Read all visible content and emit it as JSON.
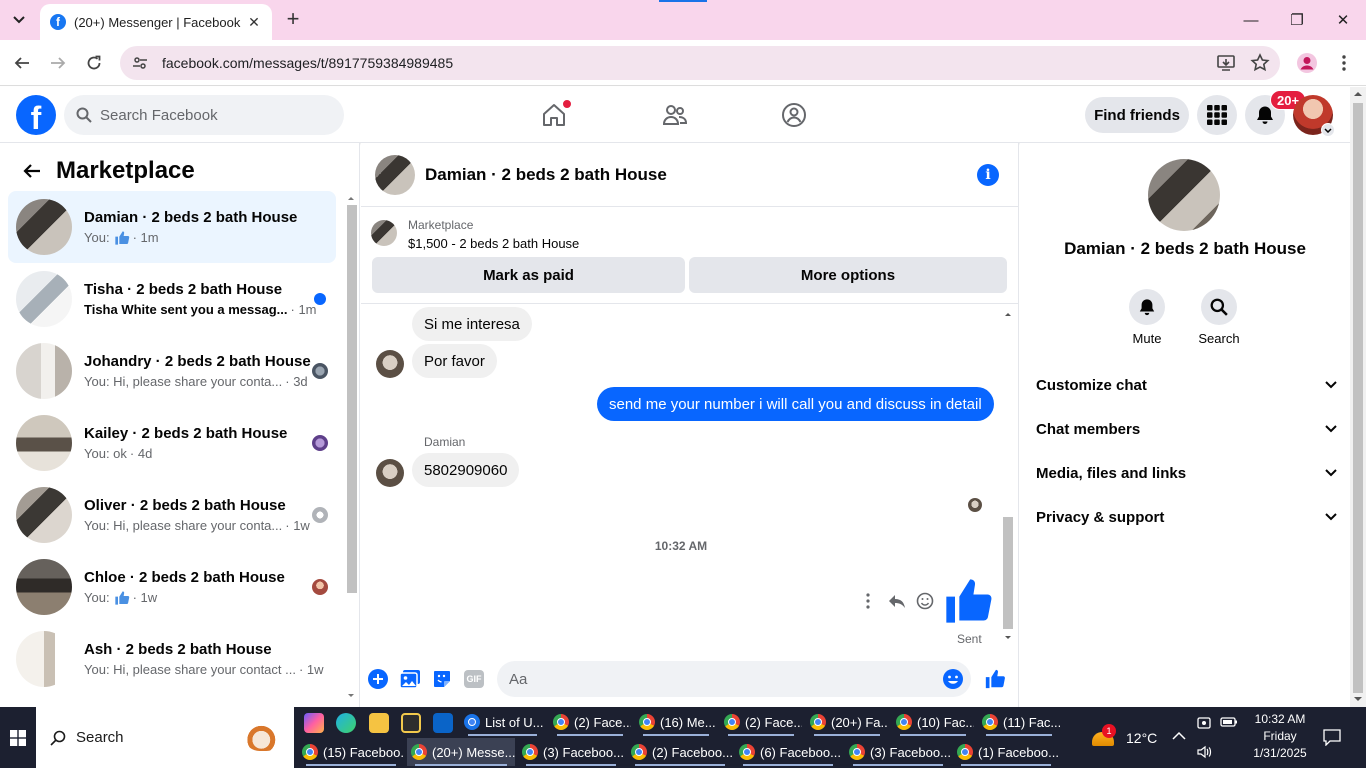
{
  "browser": {
    "tab_title": "(20+) Messenger | Facebook",
    "url": "facebook.com/messages/t/8917759384989485",
    "tab_icon": "f"
  },
  "fb": {
    "logo_letter": "f",
    "search_placeholder": "Search Facebook",
    "find_friends": "Find friends",
    "notif_badge": "20+",
    "brand_color": "#0866ff"
  },
  "left": {
    "heading": "Marketplace",
    "conversations": [
      {
        "name": "Damian · 2 beds 2 bath House",
        "preview_pre": "You:",
        "preview_text": "",
        "time": "· 1m",
        "like": true,
        "active": true,
        "unread": false
      },
      {
        "name": "Tisha · 2 beds 2 bath House",
        "preview_pre": "",
        "preview_text": "Tisha White sent you a messag...",
        "time": "· 1m",
        "like": false,
        "active": false,
        "unread": true
      },
      {
        "name": "Johandry · 2 beds 2 bath House",
        "preview_pre": "",
        "preview_text": "You: Hi, please share your conta...",
        "time": "· 3d",
        "like": false,
        "active": false,
        "unread": false
      },
      {
        "name": "Kailey · 2 beds 2 bath House",
        "preview_pre": "",
        "preview_text": "You: ok",
        "time": "· 4d",
        "like": false,
        "active": false,
        "unread": false
      },
      {
        "name": "Oliver · 2 beds 2 bath House",
        "preview_pre": "",
        "preview_text": "You: Hi, please share your conta...",
        "time": "· 1w",
        "like": false,
        "active": false,
        "unread": false
      },
      {
        "name": "Chloe · 2 beds 2 bath House",
        "preview_pre": "You:",
        "preview_text": "",
        "time": "· 1w",
        "like": true,
        "active": false,
        "unread": false
      },
      {
        "name": "Ash · 2 beds 2 bath House",
        "preview_pre": "",
        "preview_text": "You: Hi, please share your contact ...",
        "time": "· 1w",
        "like": false,
        "active": false,
        "unread": false
      }
    ]
  },
  "chat": {
    "title": "Damian · 2 beds 2 bath House",
    "info_glyph": "i",
    "marketplace_label": "Marketplace",
    "listing": "$1,500 - 2 beds 2 bath House",
    "mark_paid": "Mark as paid",
    "more_options": "More options",
    "messages": {
      "m1": "Si me interesa",
      "m2": "Por favor",
      "m3": "send me your number i will call you and discuss in detail",
      "sender": "Damian",
      "m4": "5802909060"
    },
    "timestamp": "10:32 AM",
    "sent_label": "Sent",
    "composer_placeholder": "Aa",
    "gif_label": "GIF"
  },
  "right": {
    "name": "Damian · 2 beds 2 bath House",
    "mute": "Mute",
    "search": "Search",
    "sections": [
      "Customize chat",
      "Chat members",
      "Media, files and links",
      "Privacy & support"
    ]
  },
  "taskbar": {
    "search_placeholder": "Search",
    "row1": [
      "List of U...",
      "(2) Face...",
      "(16) Me...",
      "(2) Face...",
      "(20+) Fa...",
      "(10) Fac...",
      "(11) Fac..."
    ],
    "row2": [
      "(15) Faceboo...",
      "(20+) Messe...",
      "(3) Faceboo...",
      "(2) Faceboo...",
      "(6) Faceboo...",
      "(3) Faceboo...",
      "(1) Faceboo..."
    ],
    "weather": "12°C",
    "weather_badge": "1",
    "time": "10:32 AM",
    "day": "Friday",
    "date": "1/31/2025"
  }
}
